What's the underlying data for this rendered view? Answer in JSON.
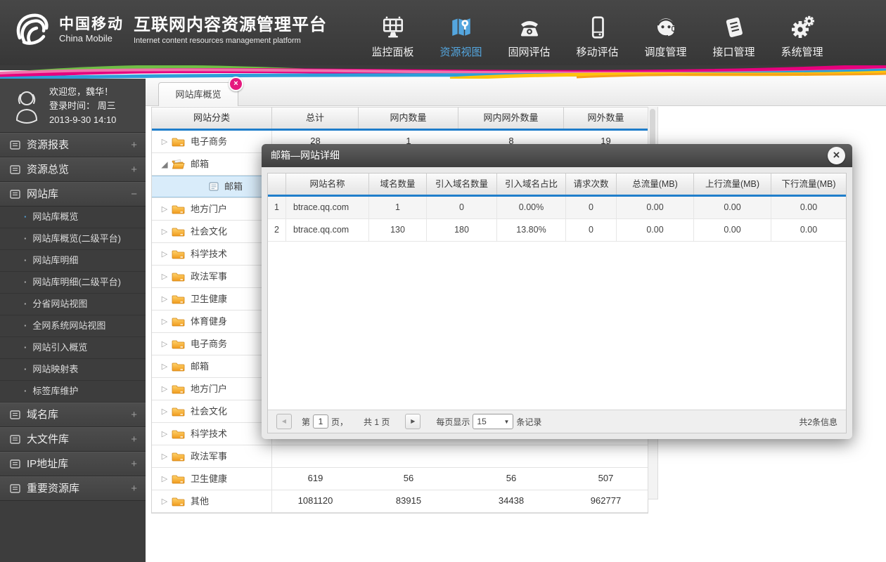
{
  "colors": {
    "accent_blue": "#1f7ecb",
    "nav_active": "#54a6df",
    "tab_close_pink": "#e5197e",
    "folder_orange": "#f5a623",
    "header_dark": "#3b3b3b"
  },
  "header": {
    "brand_cn": "中国移动",
    "brand_en": "China Mobile",
    "platform_cn": "互联网内容资源管理平台",
    "platform_en": "Internet content resources management platform",
    "nav": [
      {
        "label": "监控面板",
        "icon": "dashboard-icon",
        "active": false
      },
      {
        "label": "资源视图",
        "icon": "map-icon",
        "active": true
      },
      {
        "label": "固网评估",
        "icon": "phone-icon",
        "active": false
      },
      {
        "label": "移动评估",
        "icon": "mobile-icon",
        "active": false
      },
      {
        "label": "调度管理",
        "icon": "headset-icon",
        "active": false
      },
      {
        "label": "接口管理",
        "icon": "document-icon",
        "active": false
      },
      {
        "label": "系统管理",
        "icon": "gears-icon",
        "active": false
      }
    ]
  },
  "sidebar": {
    "welcome": "欢迎您，魏华！",
    "login_line1": "登录时间：  周三",
    "login_line2": "2013-9-30  14:10",
    "sections": [
      {
        "label": "资源报表",
        "toggle": "+",
        "expanded": false,
        "items": []
      },
      {
        "label": "资源总览",
        "toggle": "+",
        "expanded": false,
        "items": []
      },
      {
        "label": "网站库",
        "toggle": "−",
        "expanded": true,
        "items": [
          {
            "label": "网站库概览",
            "active": true
          },
          {
            "label": "网站库概览(二级平台)",
            "active": false
          },
          {
            "label": "网站库明细",
            "active": false
          },
          {
            "label": "网站库明细(二级平台)",
            "active": false
          },
          {
            "label": "分省网站视图",
            "active": false
          },
          {
            "label": "全网系统网站视图",
            "active": false
          },
          {
            "label": "网站引入概览",
            "active": false
          },
          {
            "label": "网站映射表",
            "active": false
          },
          {
            "label": "标签库维护",
            "active": false
          }
        ]
      },
      {
        "label": "域名库",
        "toggle": "+",
        "expanded": false,
        "items": []
      },
      {
        "label": "大文件库",
        "toggle": "+",
        "expanded": false,
        "items": []
      },
      {
        "label": "IP地址库",
        "toggle": "+",
        "expanded": false,
        "items": []
      },
      {
        "label": "重要资源库",
        "toggle": "+",
        "expanded": false,
        "items": []
      }
    ]
  },
  "tabs": {
    "active_tab": "网站库概览"
  },
  "main_table": {
    "headers": [
      "网站分类",
      "总计",
      "网内数量",
      "网内网外数量",
      "网外数量"
    ],
    "rows": [
      {
        "label": "电子商务",
        "icon": "folder",
        "expander": "collapsed",
        "child": false,
        "selected": false,
        "values": [
          "28",
          "1",
          "8",
          "19"
        ]
      },
      {
        "label": "邮箱",
        "icon": "folder-open",
        "expander": "expanded",
        "child": false,
        "selected": false,
        "values": [
          "",
          "",
          "",
          ""
        ]
      },
      {
        "label": "邮箱",
        "icon": "doc",
        "expander": "none",
        "child": true,
        "selected": true,
        "values": [
          "",
          "",
          "",
          ""
        ]
      },
      {
        "label": "地方门户",
        "icon": "folder",
        "expander": "collapsed",
        "child": false,
        "selected": false,
        "values": [
          "",
          "",
          "",
          ""
        ]
      },
      {
        "label": "社会文化",
        "icon": "folder",
        "expander": "collapsed",
        "child": false,
        "selected": false,
        "values": [
          "",
          "",
          "",
          ""
        ]
      },
      {
        "label": "科学技术",
        "icon": "folder",
        "expander": "collapsed",
        "child": false,
        "selected": false,
        "values": [
          "",
          "",
          "",
          ""
        ]
      },
      {
        "label": "政法军事",
        "icon": "folder",
        "expander": "collapsed",
        "child": false,
        "selected": false,
        "values": [
          "",
          "",
          "",
          ""
        ]
      },
      {
        "label": "卫生健康",
        "icon": "folder",
        "expander": "collapsed",
        "child": false,
        "selected": false,
        "values": [
          "",
          "",
          "",
          ""
        ]
      },
      {
        "label": "体育健身",
        "icon": "folder",
        "expander": "collapsed",
        "child": false,
        "selected": false,
        "values": [
          "",
          "",
          "",
          ""
        ]
      },
      {
        "label": "电子商务",
        "icon": "folder",
        "expander": "collapsed",
        "child": false,
        "selected": false,
        "values": [
          "",
          "",
          "",
          ""
        ]
      },
      {
        "label": "邮箱",
        "icon": "folder",
        "expander": "collapsed",
        "child": false,
        "selected": false,
        "values": [
          "",
          "",
          "",
          ""
        ]
      },
      {
        "label": "地方门户",
        "icon": "folder",
        "expander": "collapsed",
        "child": false,
        "selected": false,
        "values": [
          "",
          "",
          "",
          ""
        ]
      },
      {
        "label": "社会文化",
        "icon": "folder",
        "expander": "collapsed",
        "child": false,
        "selected": false,
        "values": [
          "",
          "",
          "",
          ""
        ]
      },
      {
        "label": "科学技术",
        "icon": "folder",
        "expander": "collapsed",
        "child": false,
        "selected": false,
        "values": [
          "",
          "",
          "",
          ""
        ]
      },
      {
        "label": "政法军事",
        "icon": "folder",
        "expander": "collapsed",
        "child": false,
        "selected": false,
        "values": [
          "",
          "",
          "",
          ""
        ]
      },
      {
        "label": "卫生健康",
        "icon": "folder",
        "expander": "collapsed",
        "child": false,
        "selected": false,
        "values": [
          "619",
          "56",
          "56",
          "507"
        ]
      },
      {
        "label": "其他",
        "icon": "folder",
        "expander": "collapsed",
        "child": false,
        "selected": false,
        "values": [
          "1081120",
          "83915",
          "34438",
          "962777"
        ]
      }
    ]
  },
  "modal": {
    "title": "邮箱—网站详细",
    "close_glyph": "×",
    "table": {
      "headers": [
        "",
        "网站名称",
        "域名数量",
        "引入域名数量",
        "引入域名占比",
        "请求次数",
        "总流量(MB)",
        "上行流量(MB)",
        "下行流量(MB)"
      ],
      "rows": [
        [
          "1",
          "btrace.qq.com",
          "1",
          "0",
          "0.00%",
          "0",
          "0.00",
          "0.00",
          "0.00"
        ],
        [
          "2",
          "btrace.qq.com",
          "130",
          "180",
          "13.80%",
          "0",
          "0.00",
          "0.00",
          "0.00"
        ]
      ]
    },
    "pagination": {
      "prefix": "第",
      "page": "1",
      "suffix": "页，",
      "total_pages": "共 1 页",
      "per_label": "每页显示",
      "per_value": "15",
      "per_suffix": "条记录",
      "info": "共2条信息"
    }
  }
}
